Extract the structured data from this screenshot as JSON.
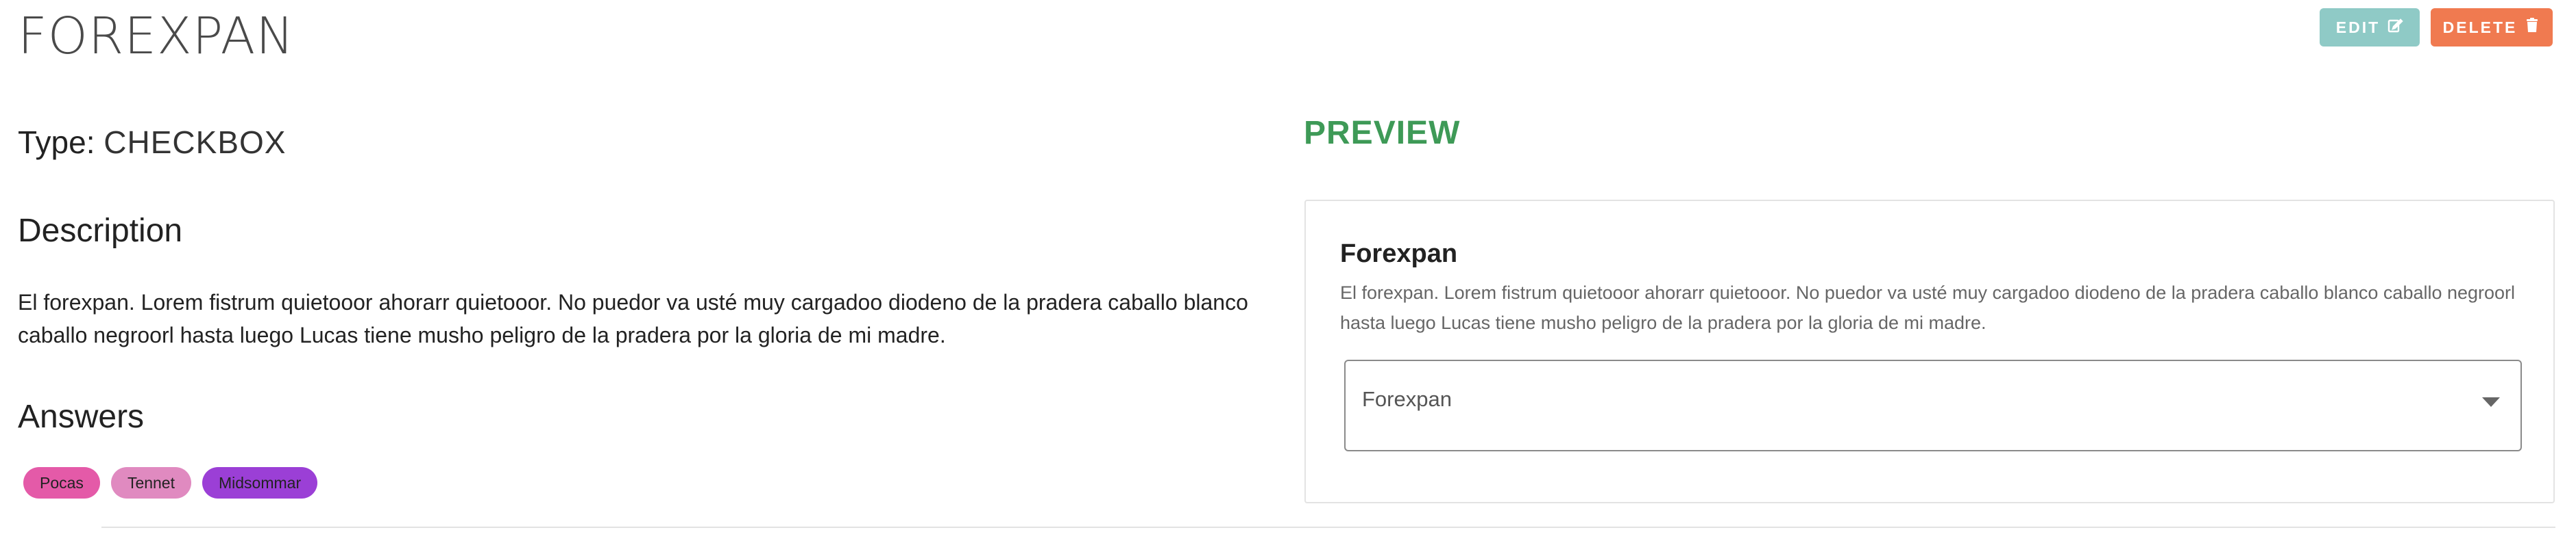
{
  "page": {
    "title": "FOREXPAN"
  },
  "actions": {
    "edit_label": "EDIT",
    "delete_label": "DELETE",
    "edit_color": "#8fcac6",
    "delete_color": "#f07a50",
    "edit_icon": "edit-icon",
    "delete_icon": "trash-icon"
  },
  "details": {
    "type_label": "Type:",
    "type_value": "CHECKBOX",
    "description_heading": "Description",
    "description_text": "El forexpan. Lorem fistrum quietooor ahorarr quietooor. No puedor va usté muy cargadoo diodeno de la pradera caballo blanco caballo negroorl hasta luego Lucas tiene musho peligro de la pradera por la gloria de mi madre.",
    "answers_heading": "Answers",
    "answers": [
      {
        "label": "Pocas",
        "color": "#e45aa8"
      },
      {
        "label": "Tennet",
        "color": "#e08ac0"
      },
      {
        "label": "Midsommar",
        "color": "#9b3fd6"
      }
    ]
  },
  "preview": {
    "heading": "PREVIEW",
    "heading_color": "#3e9a57",
    "card_title": "Forexpan",
    "card_description": "El forexpan. Lorem fistrum quietooor ahorarr quietooor. No puedor va usté muy cargadoo diodeno de la pradera caballo blanco caballo negroorl hasta luego Lucas tiene musho peligro de la pradera por la gloria de mi madre.",
    "select_value": "Forexpan",
    "select_icon": "caret-down-icon"
  }
}
